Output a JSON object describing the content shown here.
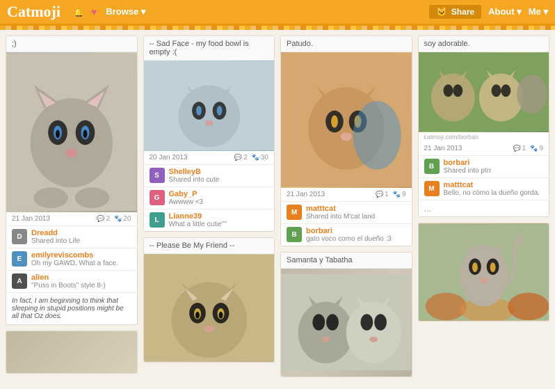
{
  "header": {
    "logo": "Catmoji",
    "nav_items": [
      "Browse ▾"
    ],
    "share_label": "Share",
    "about_label": "About ▾",
    "me_label": "Me ▾"
  },
  "col1": {
    "card1": {
      "title": ";)",
      "date": "21 Jan 2013",
      "comment_count": "2",
      "like_count": "20",
      "comments": [
        {
          "user": "Dreadd",
          "text": "Shared into Life",
          "av": "D",
          "av_color": "av-gray"
        },
        {
          "user": "emilyreviscombs",
          "text": "Oh my GAWD. What a face.",
          "av": "E",
          "av_color": "av-blue"
        },
        {
          "user": "alien",
          "text": "\"Puss in Boots\" style 8-)",
          "av": "A",
          "av_color": "av-dark"
        }
      ],
      "text_block": "In fact, I am beginning to think that sleeping in stupid positions might be all that Oz does."
    }
  },
  "col2": {
    "card1": {
      "title": "-- Sad Face - my food bowl is empty :(",
      "date": "20 Jan 2013",
      "comment_count": "2",
      "like_count": "30",
      "comments": [
        {
          "user": "ShelleyB",
          "text": "Shared into cute",
          "av": "S",
          "av_color": "av-purple"
        },
        {
          "user": "Gaby_P",
          "text": "Awwww <3",
          "av": "G",
          "av_color": "av-pink"
        },
        {
          "user": "Lianne39",
          "text": "What a little cutie\"\"",
          "av": "L",
          "av_color": "av-teal"
        }
      ]
    },
    "card2": {
      "title": "-- Please Be My Friend --"
    }
  },
  "col3": {
    "card1": {
      "title": "Patudo.",
      "date": "21 Jan 2013",
      "comment_count": "1",
      "like_count": "9",
      "comments": [
        {
          "user": "matttcat",
          "text": "Shared into M'cat land",
          "av": "M",
          "av_color": "av-orange"
        },
        {
          "user": "borbari",
          "text": "gato voco como el dueño :3",
          "av": "B",
          "av_color": "av-green"
        }
      ]
    },
    "card2": {
      "title": "Samanta y Tabatha"
    }
  },
  "col4": {
    "card1": {
      "title": "soy adorable.",
      "watermark": "catmoji.com/borbari",
      "date": "21 Jan 2013",
      "comment_count": "1",
      "like_count": "9",
      "comments": [
        {
          "user": "borbari",
          "text": "Shared into ptrr",
          "av": "B",
          "av_color": "av-green"
        },
        {
          "user": "matttcat",
          "text": "Bello, no cómo la dueño gorda.",
          "av": "M",
          "av_color": "av-orange"
        }
      ],
      "dots": "..."
    }
  }
}
